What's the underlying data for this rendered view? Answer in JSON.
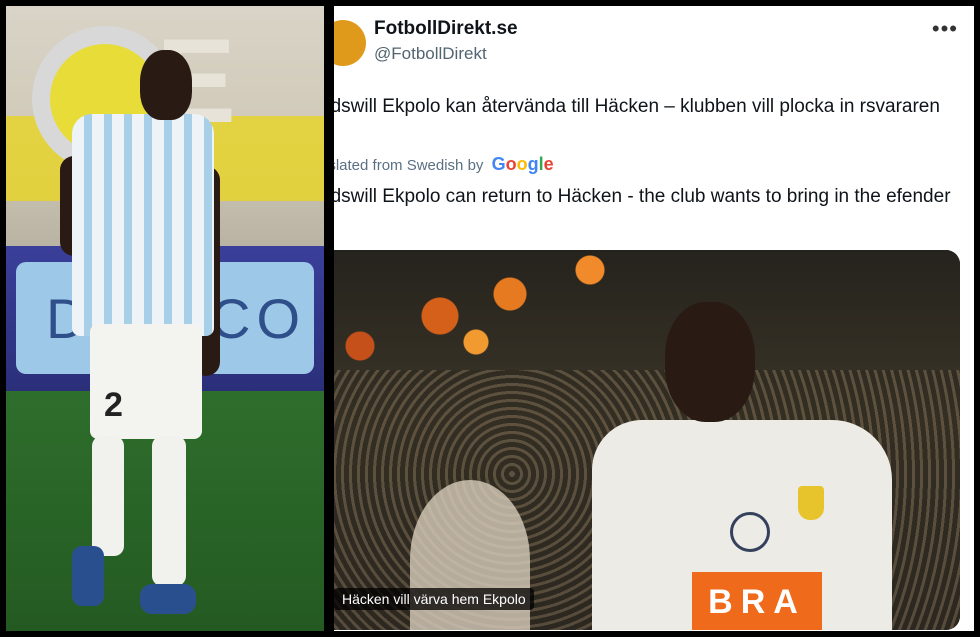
{
  "left_photo": {
    "board_text": "DIMACO",
    "shirt_number": "2"
  },
  "tweet": {
    "author_name": "FotbollDirekt.se",
    "author_handle": "@FotbollDirekt",
    "more_icon": "more-options-icon",
    "original_text": "odswill Ekpolo kan återvända till Häcken – klubben vill plocka in rsvararen",
    "translated_from_label": "nslated from Swedish by",
    "translator": "Google",
    "translated_text": "odswill Ekpolo can return to Häcken - the club wants to bring in the efender",
    "media": {
      "caption": "Häcken vill värva hem Ekpolo",
      "sponsor_text": "BRA"
    }
  },
  "colors": {
    "tweet_bg": "#ffffff",
    "text_primary": "#0f1419",
    "text_secondary": "#536471",
    "translation_label": "#5b7083",
    "sponsor_orange": "#ef6a1a"
  }
}
